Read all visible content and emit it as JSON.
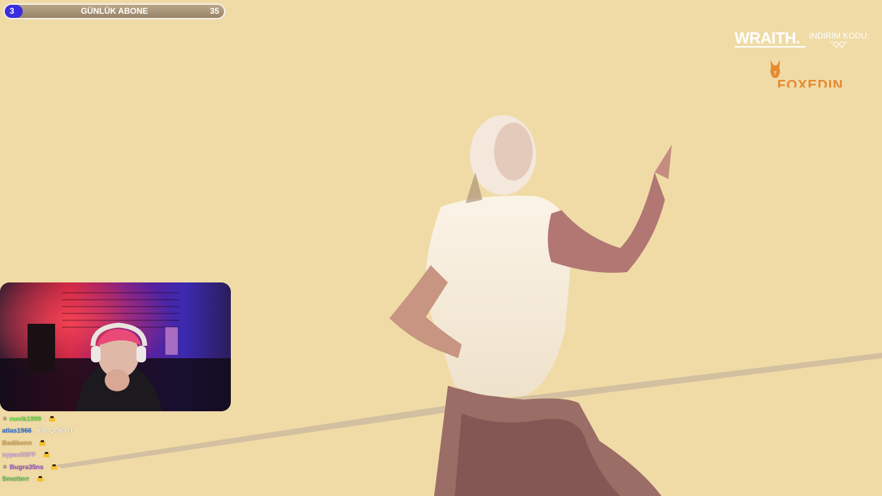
{
  "sub_goal": {
    "current": "3",
    "title": "GÜNLÜK ABONE",
    "target": "35",
    "bar_color": "#3a2de0"
  },
  "sponsor": {
    "brand": "WRAITH.",
    "code_label": "İNDİRİM KODU:",
    "code_value": "\"QQ\"",
    "partner": "FOXEDIN",
    "partner_color": "#e58b32"
  },
  "chat": {
    "messages": [
      {
        "badge": "emoji-badge-icon",
        "user": "nuvik1999",
        "user_color": "#5fd13f",
        "text": "",
        "emote": true
      },
      {
        "badge": "",
        "user": "atlas1966",
        "user_color": "#2d6ed8",
        "text": "KİK ÇÖKTÜ",
        "emote": false
      },
      {
        "badge": "",
        "user": "Badibenn",
        "user_color": "#d4a04a",
        "text": "",
        "emote": true
      },
      {
        "badge": "",
        "user": "sypex55FF",
        "user_color": "#c8a2d8",
        "text": "",
        "emote": true
      },
      {
        "badge": "emoji-badge-icon",
        "user": "Bugra35ns",
        "user_color": "#9b4fd6",
        "text": "",
        "emote": true
      },
      {
        "badge": "",
        "user": "Smotterr",
        "user_color": "#43c943",
        "text": "",
        "emote": true
      }
    ]
  }
}
